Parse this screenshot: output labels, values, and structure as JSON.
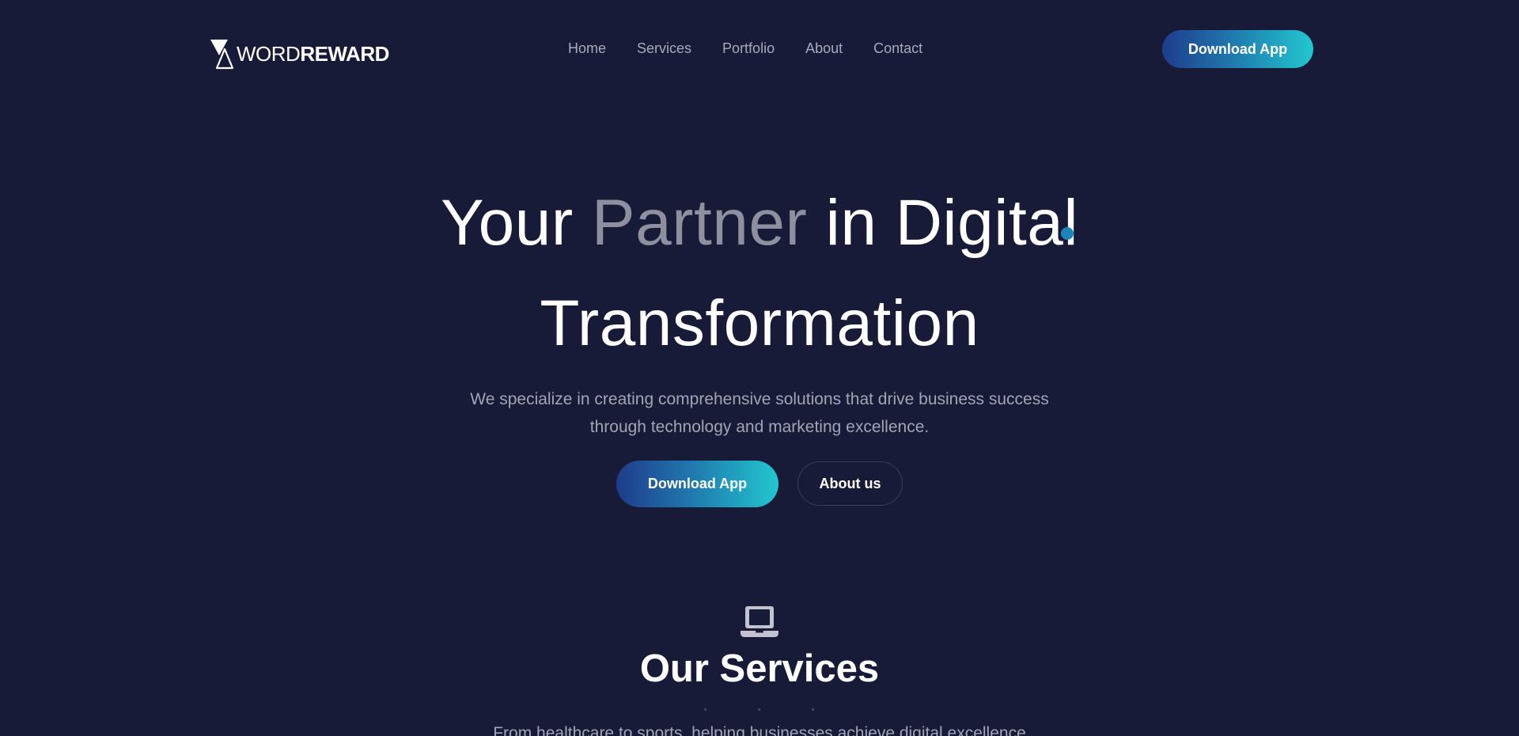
{
  "header": {
    "logo": {
      "light": "WORD",
      "bold": "REWARD"
    },
    "nav": [
      {
        "label": "Home"
      },
      {
        "label": "Services"
      },
      {
        "label": "Portfolio"
      },
      {
        "label": "About"
      },
      {
        "label": "Contact"
      }
    ],
    "cta_label": "Download App"
  },
  "hero": {
    "title_part1": "Your ",
    "title_highlight": "Partner",
    "title_part2": " in Digital",
    "title_line2": "Transformation",
    "subtitle": "We specialize in creating comprehensive solutions that drive business success through technology and marketing excellence.",
    "primary_cta": "Download App",
    "secondary_cta": "About us"
  },
  "services": {
    "icon": "laptop-icon",
    "title": "Our Services",
    "subtitle": "From healthcare to sports, helping businesses achieve digital excellence"
  },
  "colors": {
    "background": "#181b37",
    "accent_start": "#1f3c8c",
    "accent_end": "#22c6cf",
    "muted_text": "#a2a4b6",
    "highlight_text": "#8e8f9f"
  }
}
